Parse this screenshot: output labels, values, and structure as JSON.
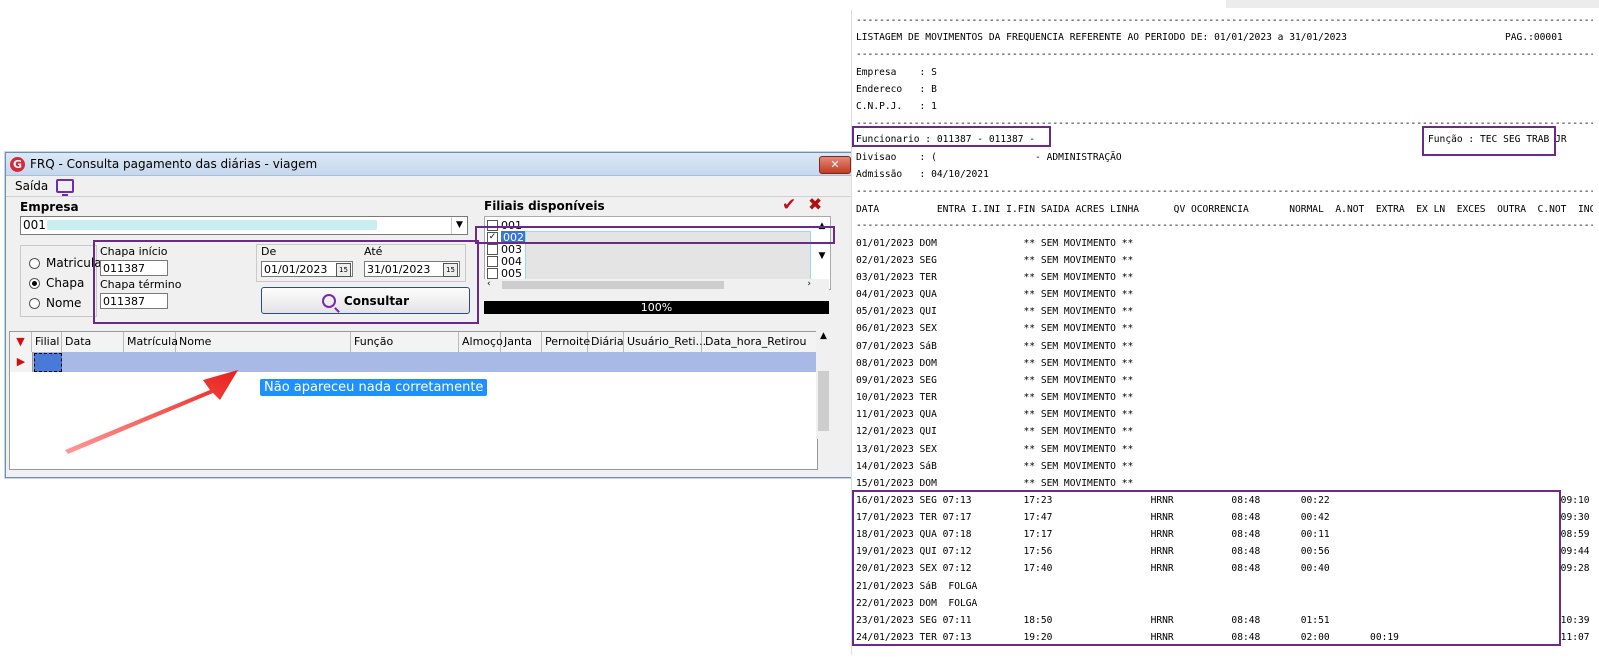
{
  "window": {
    "title": "FRQ - Consulta pagamento das diárias - viagem",
    "close_glyph": "✕"
  },
  "menu": {
    "saida": "Saída"
  },
  "empresa": {
    "label": "Empresa",
    "value": "001"
  },
  "filtros": {
    "radio_matricula": "Matricula",
    "radio_chapa": "Chapa",
    "radio_nome": "Nome",
    "selected": "Chapa",
    "chapa_inicio_label": "Chapa início",
    "chapa_inicio_value": "011387",
    "chapa_termino_label": "Chapa término",
    "chapa_termino_value": "011387",
    "de_label": "De",
    "de_value": "01/01/2023",
    "ate_label": "Até",
    "ate_value": "31/01/2023",
    "cal_glyph": "15",
    "consultar_label": "Consultar"
  },
  "filiais": {
    "label": "Filiais disponíveis",
    "items": [
      {
        "code": "001",
        "checked": false
      },
      {
        "code": "002",
        "checked": true
      },
      {
        "code": "003",
        "checked": false
      },
      {
        "code": "004",
        "checked": false
      },
      {
        "code": "005",
        "checked": false
      }
    ],
    "progress_text": "100%"
  },
  "grid": {
    "columns": [
      "Filial",
      "Data",
      "Matrícula",
      "Nome",
      "Função",
      "Almoço",
      "Janta",
      "Pernoite",
      "Diária",
      "Usuário_Reti...",
      "Data_hora_Retirou"
    ]
  },
  "annotation": "Não apareceu nada corretamente",
  "report": {
    "separator": "------------------------------------------------------------------------------------------------------------------------------------------------",
    "title_line": "LISTAGEM DE MOVIMENTOS DA FREQUENCIA REFERENTE AO PERIODO DE: 01/01/2023 a 31/01/2023",
    "page": "PAG.:00001",
    "empresa": "Empresa    : S",
    "endereco": "Endereco   : B",
    "cnpj": "C.N.P.J.   : 1",
    "funcionario": "Funcionario : 011387 - 011387 -",
    "funcao": "Função : TEC SEG TRAB JR",
    "divisao": "Divisao    : (                 - ADMINISTRAÇÃO",
    "admissao": "Admissão   : 04/10/2021",
    "header": "DATA          ENTRA I.INI I.FIN SAIDA ACRES LINHA      QV OCORRENCIA       NORMAL  A.NOT  EXTRA  EX LN  EXCES  OUTRA  C.NOT  INCOM  TOTAL",
    "rows": [
      "01/01/2023 DOM               ** SEM MOVIMENTO **",
      "02/01/2023 SEG               ** SEM MOVIMENTO **",
      "03/01/2023 TER               ** SEM MOVIMENTO **",
      "04/01/2023 QUA               ** SEM MOVIMENTO **",
      "05/01/2023 QUI               ** SEM MOVIMENTO **",
      "06/01/2023 SEX               ** SEM MOVIMENTO **",
      "07/01/2023 SáB               ** SEM MOVIMENTO **",
      "08/01/2023 DOM               ** SEM MOVIMENTO **",
      "09/01/2023 SEG               ** SEM MOVIMENTO **",
      "10/01/2023 TER               ** SEM MOVIMENTO **",
      "11/01/2023 QUA               ** SEM MOVIMENTO **",
      "12/01/2023 QUI               ** SEM MOVIMENTO **",
      "13/01/2023 SEX               ** SEM MOVIMENTO **",
      "14/01/2023 SáB               ** SEM MOVIMENTO **",
      "15/01/2023 DOM               ** SEM MOVIMENTO **",
      "16/01/2023 SEG 07:13         17:23                 HRNR          08:48       00:22                                        09:10",
      "17/01/2023 TER 07:17         17:47                 HRNR          08:48       00:42                                        09:30",
      "18/01/2023 QUA 07:18         17:17                 HRNR          08:48       00:11                                        08:59",
      "19/01/2023 QUI 07:12         17:56                 HRNR          08:48       00:56                                        09:44",
      "20/01/2023 SEX 07:12         17:40                 HRNR          08:48       00:40                                        09:28",
      "21/01/2023 SáB  FOLGA",
      "22/01/2023 DOM  FOLGA",
      "23/01/2023 SEG 07:11         18:50                 HRNR          08:48       01:51                                        10:39",
      "24/01/2023 TER 07:13         19:20                 HRNR          08:48       02:00       00:19                            11:07"
    ]
  },
  "colors": {
    "highlight_purple": "#6b2a8a",
    "yellow": "#ffff88",
    "annotation_blue": "#1e90ff",
    "arrow_red": "#e8201a"
  }
}
